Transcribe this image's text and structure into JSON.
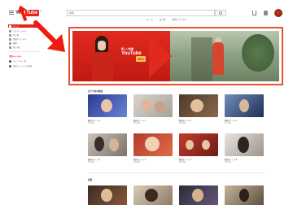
{
  "header": {
    "logo_you": "You",
    "logo_tube": "Tube",
    "logo_region": "JP",
    "search": {
      "value": "",
      "placeholder": "検索"
    },
    "tabs": [
      "ホーム",
      "急上昇",
      "登録チャンネル"
    ]
  },
  "sidebar": {
    "items": [
      {
        "label": "ホーム",
        "icon": "home-icon",
        "active": true
      },
      {
        "label": "マイチャンネル",
        "icon": "channel-icon",
        "active": false
      },
      {
        "label": "急上昇",
        "icon": "trending-icon",
        "active": false
      },
      {
        "label": "登録チャンネル",
        "icon": "subscriptions-icon",
        "active": false
      },
      {
        "label": "履歴",
        "icon": "history-icon",
        "active": false
      },
      {
        "label": "後で見る",
        "icon": "watch-later-icon",
        "active": false
      }
    ],
    "section_heading": "登録チャンネル",
    "sub_items": [
      {
        "label": "チャンネル一覧"
      },
      {
        "label": "登録チャンネルを管理"
      }
    ]
  },
  "banner": {
    "line1": "新しい体験",
    "line2": "YouTube",
    "badge": "30%"
  },
  "sections": [
    {
      "title": "おすすめの動画",
      "rows": [
        [
          {
            "title": "動画タイトル 1",
            "meta": "再生回数"
          },
          {
            "title": "動画タイトル 2",
            "meta": "再生回数"
          },
          {
            "title": "動画タイトル 3",
            "meta": "再生回数"
          },
          {
            "title": "動画タイトル 4",
            "meta": "再生回数"
          }
        ],
        [
          {
            "title": "動画タイトル 5",
            "meta": "再生回数"
          },
          {
            "title": "動画タイトル 6",
            "meta": "再生回数"
          },
          {
            "title": "動画タイトル 7",
            "meta": "再生回数"
          },
          {
            "title": "動画タイトル 8",
            "meta": "再生回数"
          }
        ]
      ]
    },
    {
      "title": "音楽",
      "rows": [
        [
          {
            "title": "",
            "meta": ""
          },
          {
            "title": "",
            "meta": ""
          },
          {
            "title": "",
            "meta": ""
          },
          {
            "title": "",
            "meta": ""
          }
        ]
      ]
    }
  ],
  "colors": {
    "brand_red": "#e62117",
    "highlight_border": "#e8532f",
    "annotation_arrow": "#ee1c10"
  }
}
